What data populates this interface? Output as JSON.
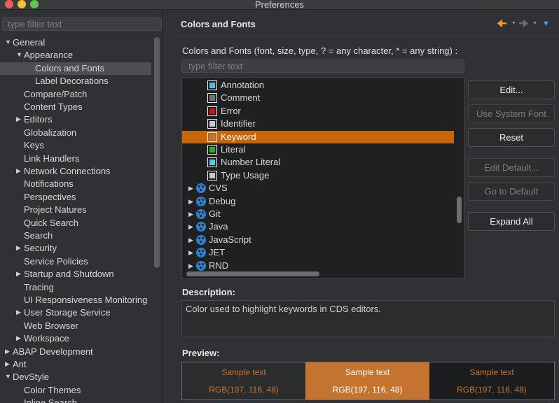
{
  "window": {
    "title": "Preferences"
  },
  "left": {
    "filter_placeholder": "type filter text",
    "tree": [
      {
        "label": "General",
        "level": 0,
        "expanded": true
      },
      {
        "label": "Appearance",
        "level": 1,
        "expanded": true
      },
      {
        "label": "Colors and Fonts",
        "level": 2,
        "selected": true
      },
      {
        "label": "Label Decorations",
        "level": 2
      },
      {
        "label": "Compare/Patch",
        "level": 1
      },
      {
        "label": "Content Types",
        "level": 1
      },
      {
        "label": "Editors",
        "level": 1,
        "collapsed": true
      },
      {
        "label": "Globalization",
        "level": 1
      },
      {
        "label": "Keys",
        "level": 1
      },
      {
        "label": "Link Handlers",
        "level": 1
      },
      {
        "label": "Network Connections",
        "level": 1,
        "collapsed": true
      },
      {
        "label": "Notifications",
        "level": 1
      },
      {
        "label": "Perspectives",
        "level": 1
      },
      {
        "label": "Project Natures",
        "level": 1
      },
      {
        "label": "Quick Search",
        "level": 1
      },
      {
        "label": "Search",
        "level": 1
      },
      {
        "label": "Security",
        "level": 1,
        "collapsed": true
      },
      {
        "label": "Service Policies",
        "level": 1
      },
      {
        "label": "Startup and Shutdown",
        "level": 1,
        "collapsed": true
      },
      {
        "label": "Tracing",
        "level": 1
      },
      {
        "label": "UI Responsiveness Monitoring",
        "level": 1
      },
      {
        "label": "User Storage Service",
        "level": 1,
        "collapsed": true
      },
      {
        "label": "Web Browser",
        "level": 1
      },
      {
        "label": "Workspace",
        "level": 1,
        "collapsed": true
      },
      {
        "label": "ABAP Development",
        "level": 0,
        "collapsed": true
      },
      {
        "label": "Ant",
        "level": 0,
        "collapsed": true
      },
      {
        "label": "DevStyle",
        "level": 0,
        "expanded": true
      },
      {
        "label": "Color Themes",
        "level": 1
      },
      {
        "label": "Inline Search",
        "level": 1
      }
    ]
  },
  "right": {
    "header_title": "Colors and Fonts",
    "intro": "Colors and Fonts (font, size, type, ? = any character, * = any string) :",
    "filter_placeholder": "type filter text",
    "items": [
      {
        "type": "color",
        "label": "Annotation",
        "color": "#5ab4e6"
      },
      {
        "type": "color",
        "label": "Comment",
        "color": "#6e747c"
      },
      {
        "type": "color",
        "label": "Error",
        "color": "#c8101a"
      },
      {
        "type": "color",
        "label": "Identifier",
        "color": "#c9c9c9"
      },
      {
        "type": "color",
        "label": "Keyword",
        "color": "#c57430",
        "selected": true
      },
      {
        "type": "color",
        "label": "Literal",
        "color": "#2fa82f"
      },
      {
        "type": "color",
        "label": "Number Literal",
        "color": "#55c8ee"
      },
      {
        "type": "color",
        "label": "Type Usage",
        "color": "#c9c9c9"
      },
      {
        "type": "category",
        "label": "CVS"
      },
      {
        "type": "category",
        "label": "Debug"
      },
      {
        "type": "category",
        "label": "Git"
      },
      {
        "type": "category",
        "label": "Java"
      },
      {
        "type": "category",
        "label": "JavaScript"
      },
      {
        "type": "category",
        "label": "JET"
      },
      {
        "type": "category",
        "label": "RND"
      }
    ],
    "buttons": {
      "edit": "Edit...",
      "use_system_font": "Use System Font",
      "reset": "Reset",
      "edit_default": "Edit Default...",
      "go_to_default": "Go to Default",
      "expand_all": "Expand All"
    },
    "description_label": "Description:",
    "description_text": "Color used to highlight keywords in CDS editors.",
    "preview_label": "Preview:",
    "preview": [
      {
        "sample": "Sample text",
        "rgb": "RGB(197, 116, 48)"
      },
      {
        "sample": "Sample text",
        "rgb": "RGB(197, 116, 48)"
      },
      {
        "sample": "Sample text",
        "rgb": "RGB(197, 116, 48)"
      }
    ]
  },
  "colors": {
    "accent_orange": "#c5742f",
    "selection_orange": "#c9650a"
  },
  "icons": {
    "back": "arrow-left-icon",
    "forward": "arrow-right-icon",
    "menu": "chevron-down-icon",
    "category": "palette-icon"
  }
}
